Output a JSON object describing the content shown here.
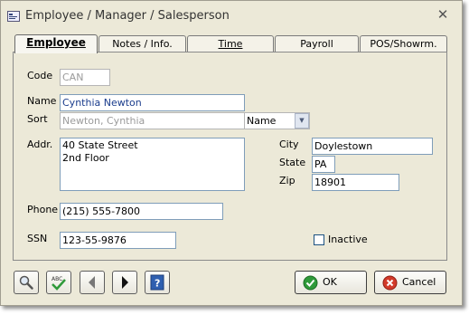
{
  "window": {
    "title": "Employee / Manager / Salesperson"
  },
  "tabs": [
    {
      "label": "Employee"
    },
    {
      "label": "Notes / Info."
    },
    {
      "label": "Time"
    },
    {
      "label": "Payroll"
    },
    {
      "label": "POS/Showrm."
    }
  ],
  "form": {
    "code_label": "Code",
    "code_value": "CAN",
    "name_label": "Name",
    "name_value": "Cynthia Newton",
    "sort_label": "Sort",
    "sort_value": "Newton, Cynthia",
    "sort_by_value": "Name",
    "addr_label": "Addr.",
    "addr_value": "40 State Street\n2nd Floor",
    "city_label": "City",
    "city_value": "Doylestown",
    "state_label": "State",
    "state_value": "PA",
    "zip_label": "Zip",
    "zip_value": "18901",
    "phone_label": "Phone",
    "phone_value": "(215) 555-7800",
    "ssn_label": "SSN",
    "ssn_value": "123-55-9876",
    "inactive_label": "Inactive",
    "inactive_checked": false
  },
  "buttons": {
    "ok_label": "OK",
    "cancel_label": "Cancel"
  },
  "toolbar_icons": [
    "search-icon",
    "spellcheck-icon",
    "previous-icon",
    "next-icon",
    "help-icon"
  ],
  "colors": {
    "ok_green": "#2f9a3a",
    "cancel_red": "#d23a2a",
    "field_border": "#7f9db9"
  }
}
